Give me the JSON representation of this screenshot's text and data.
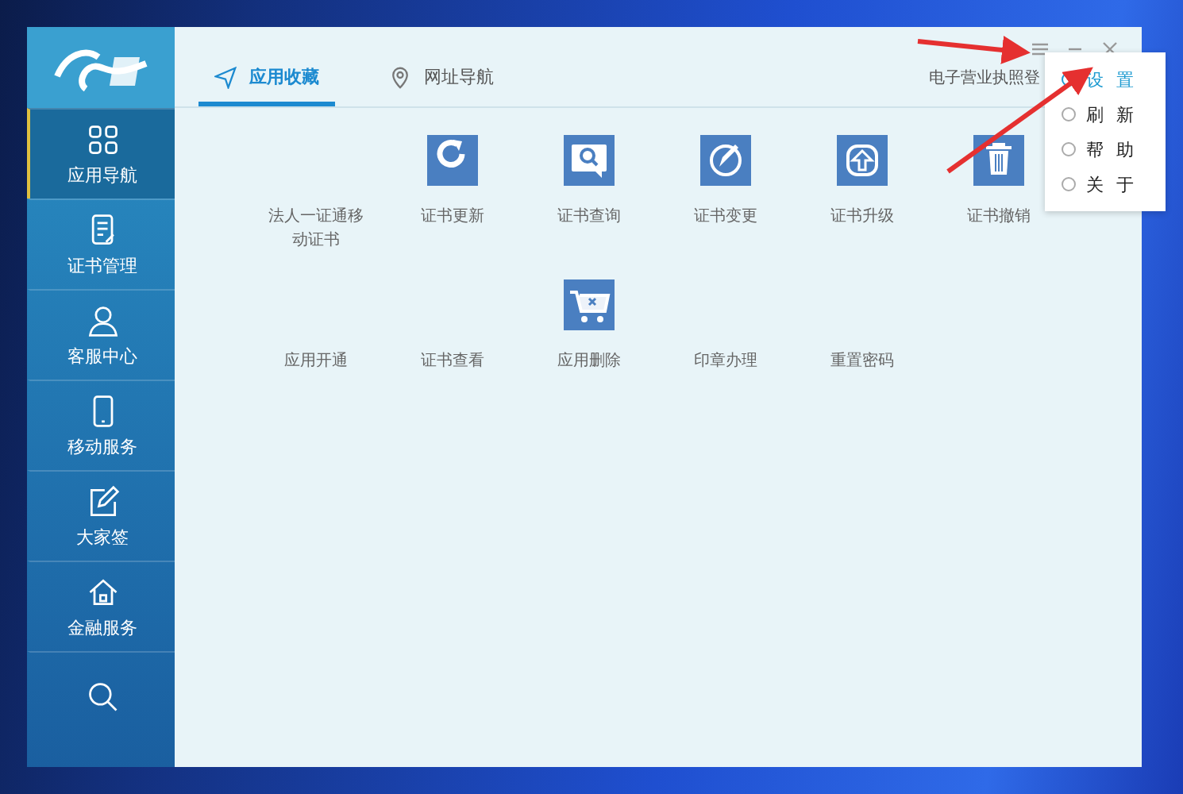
{
  "sidebar": {
    "items": [
      {
        "label": "应用导航",
        "kind": "grid",
        "selected": true
      },
      {
        "label": "证书管理",
        "kind": "document",
        "selected": false
      },
      {
        "label": "客服中心",
        "kind": "person",
        "selected": false
      },
      {
        "label": "移动服务",
        "kind": "phone",
        "selected": false
      },
      {
        "label": "大家签",
        "kind": "pen",
        "selected": false
      },
      {
        "label": "金融服务",
        "kind": "house",
        "selected": false
      },
      {
        "kind": "search",
        "selected": false
      }
    ]
  },
  "tabs": [
    {
      "label": "应用收藏",
      "kind": "send",
      "selected": true
    },
    {
      "label": "网址导航",
      "kind": "pin",
      "selected": false
    }
  ],
  "header_text": "电子营业执照登",
  "apps": [
    {
      "label": "法人一证通移动证书",
      "kind": "plain"
    },
    {
      "label": "证书更新",
      "kind": "refresh"
    },
    {
      "label": "证书查询",
      "kind": "query"
    },
    {
      "label": "证书变更",
      "kind": "edit"
    },
    {
      "label": "证书升级",
      "kind": "upgrade"
    },
    {
      "label": "证书撤销",
      "kind": "delete"
    },
    {
      "label": "应用开通",
      "kind": "plain"
    },
    {
      "label": "证书查看",
      "kind": "plain"
    },
    {
      "label": "应用删除",
      "kind": "cart"
    },
    {
      "label": "印章办理",
      "kind": "plain"
    },
    {
      "label": "重置密码",
      "kind": "plain"
    }
  ],
  "menu": [
    {
      "label": "设置",
      "selected": true
    },
    {
      "label": "刷新",
      "selected": false
    },
    {
      "label": "帮助",
      "selected": false
    },
    {
      "label": "关于",
      "selected": false
    }
  ]
}
